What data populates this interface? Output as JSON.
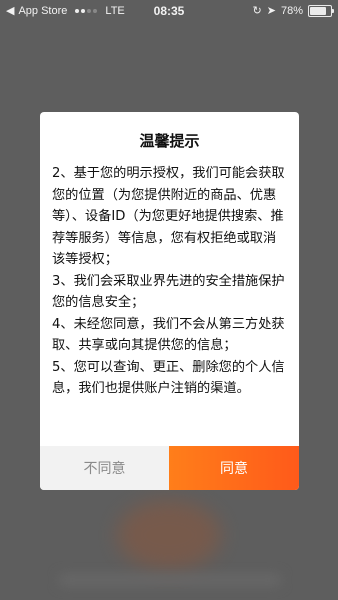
{
  "status_bar": {
    "back_app": "App Store",
    "network": "LTE",
    "time": "08:35",
    "battery": "78%",
    "battery_level": 0.78
  },
  "dialog": {
    "title": "温馨提示",
    "items": [
      "2、基于您的明示授权，我们可能会获取您的位置（为您提供附近的商品、优惠等）、设备ID（为您更好地提供搜索、推荐等服务）等信息，您有权拒绝或取消该等授权；",
      "3、我们会采取业界先进的安全措施保护您的信息安全；",
      "4、未经您同意，我们不会从第三方处获取、共享或向其提供您的信息；",
      "5、您可以查询、更正、删除您的个人信息，我们也提供账户注销的渠道。"
    ],
    "decline_label": "不同意",
    "agree_label": "同意"
  },
  "colors": {
    "agree_start": "#ff7e1a",
    "agree_end": "#ff5a1a",
    "decline_bg": "#f2f2f2",
    "overlay": "#5e5e5e"
  }
}
